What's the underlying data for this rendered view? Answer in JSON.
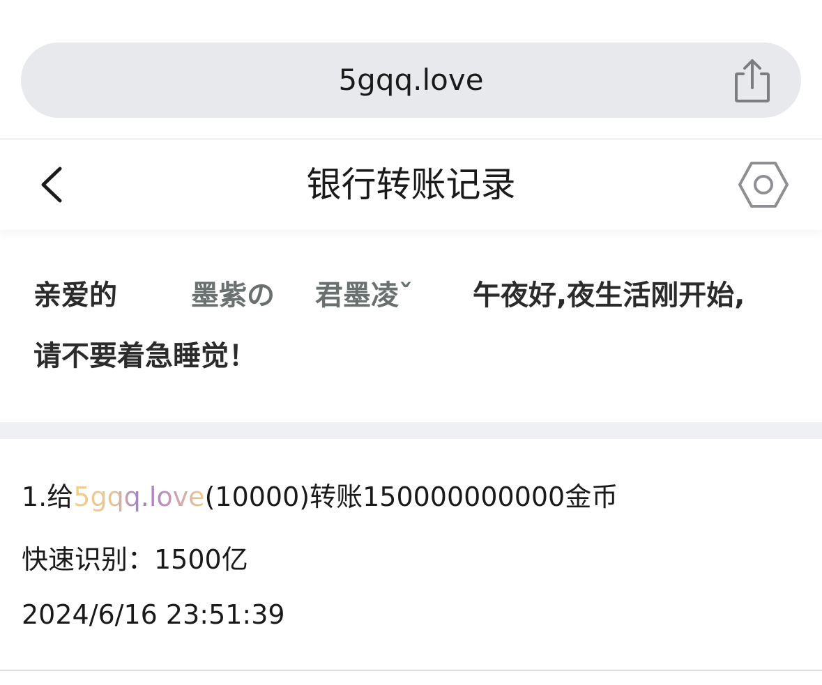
{
  "browser": {
    "url": "5gqq.love",
    "share_icon": "share-icon"
  },
  "header": {
    "title": "银行转账记录",
    "back_icon": "chevron-left-icon",
    "settings_icon": "hexagon-settings-icon"
  },
  "greeting": {
    "prefix": "亲爱的",
    "name_part1": "墨紫の",
    "name_part2": "君墨凌ˇ",
    "suffix": "午夜好,夜生活刚开始,",
    "line2": "请不要着急睡觉！"
  },
  "record": {
    "index_prefix": "1.给",
    "site_name": "5gqq.love",
    "middle": "(10000)转账150000000000金币",
    "quick_label": "快速识别：1500亿",
    "timestamp": "2024/6/16 23:51:39"
  },
  "colors": {
    "url_bar_bg": "#e8e9ed",
    "name_gray": "#6a6f70",
    "section_sep": "#eff0f4"
  }
}
